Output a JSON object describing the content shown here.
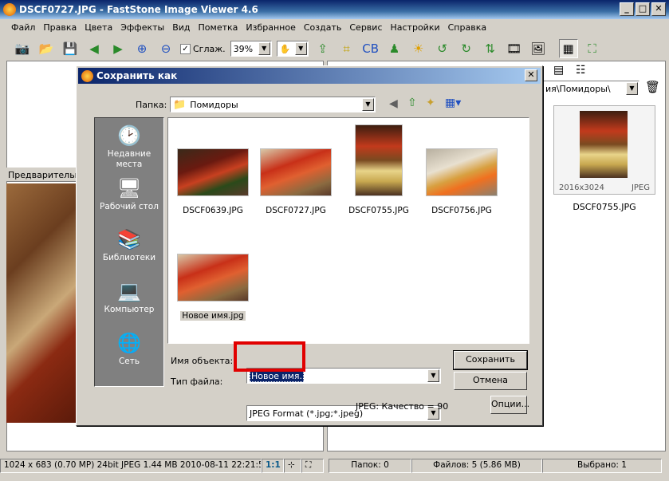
{
  "window": {
    "title": "DSCF0727.JPG - FastStone Image Viewer 4.6"
  },
  "menu": [
    "Файл",
    "Правка",
    "Цвета",
    "Эффекты",
    "Вид",
    "Пометка",
    "Избранное",
    "Создать",
    "Сервис",
    "Настройки",
    "Справка"
  ],
  "toolbar": {
    "smooth_label": "Сглаж.",
    "zoom_value": "39%"
  },
  "left_panel": {
    "preview_label": "Предварительны"
  },
  "right_panel": {
    "path_value": "ия\\Помидоры\\",
    "thumb": {
      "name": "DSCF0755.JPG",
      "dimensions": "2016x3024",
      "format": "JPEG"
    }
  },
  "status": {
    "image_info": "1024 x 683 (0.70 MP)  24bit  JPEG   1.44 MB   2010-08-11 22:21:56",
    "zoom": "1:1",
    "folders": "Папок: 0",
    "files": "Файлов: 5 (5.86 MB)",
    "selected": "Выбрано: 1"
  },
  "dialog": {
    "title": "Сохранить как",
    "folder_label": "Папка:",
    "folder_value": "Помидоры",
    "places": [
      {
        "label": "Недавние места",
        "icon": "recent-places-icon"
      },
      {
        "label": "Рабочий стол",
        "icon": "desktop-icon"
      },
      {
        "label": "Библиотеки",
        "icon": "libraries-icon"
      },
      {
        "label": "Компьютер",
        "icon": "computer-icon"
      },
      {
        "label": "Сеть",
        "icon": "network-icon"
      }
    ],
    "files": [
      {
        "name": "DSCF0639.JPG"
      },
      {
        "name": "DSCF0727.JPG"
      },
      {
        "name": "DSCF0755.JPG"
      },
      {
        "name": "DSCF0756.JPG"
      },
      {
        "name": "Новое имя.jpg"
      }
    ],
    "filename_label": "Имя объекта:",
    "filename_value": "Новое имя.",
    "filetype_label": "Тип файла:",
    "filetype_value": "JPEG Format (*.jpg;*.jpeg)",
    "quality_text": "JPEG: Качество = 90",
    "save_button": "Сохранить",
    "cancel_button": "Отмена",
    "options_button": "Опции..."
  }
}
